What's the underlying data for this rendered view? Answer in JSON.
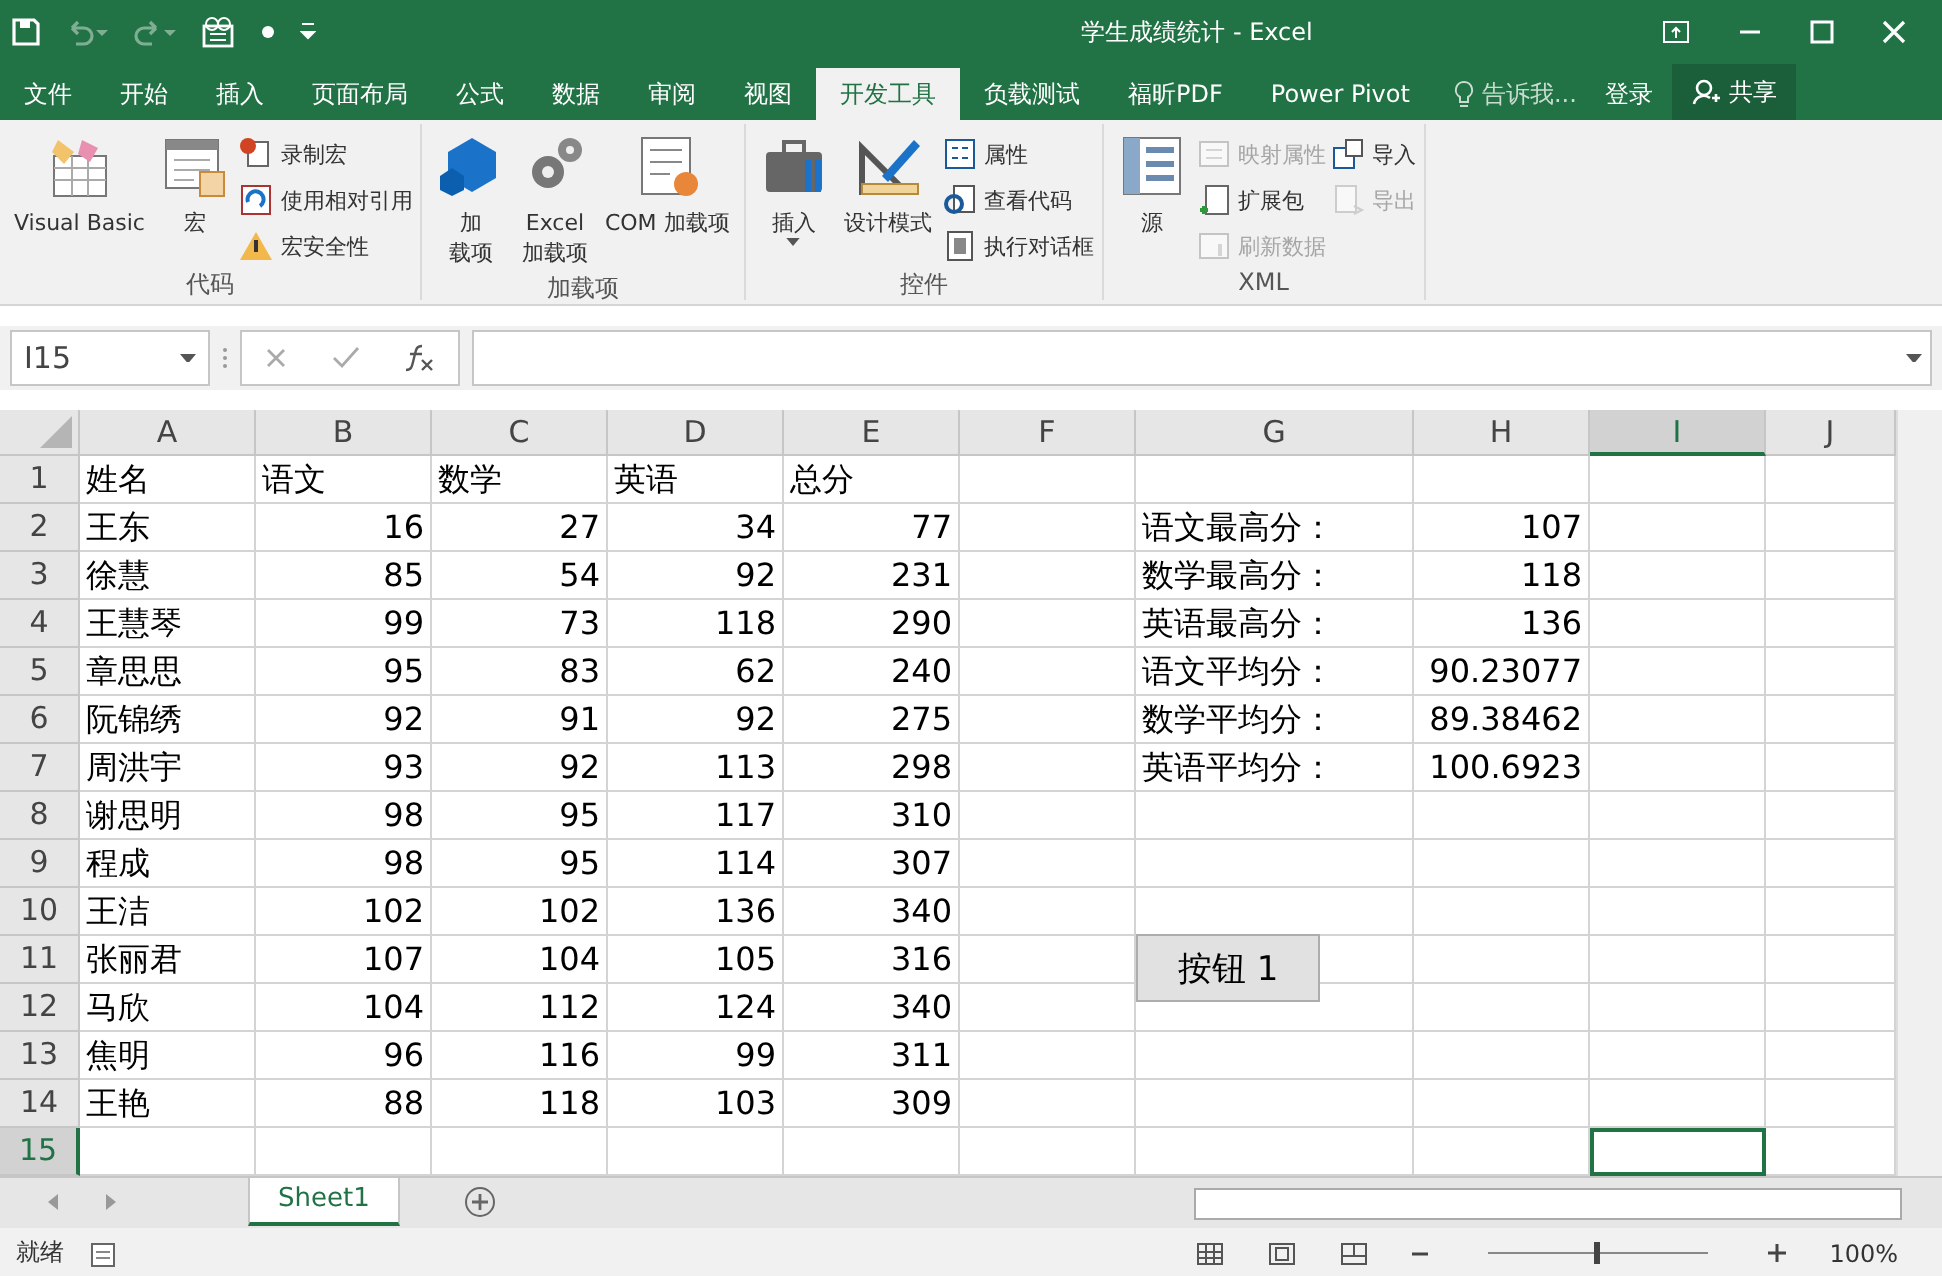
{
  "window": {
    "title": "学生成绩统计 - Excel"
  },
  "tabs": [
    {
      "label": "文件",
      "selected": false
    },
    {
      "label": "开始",
      "selected": false
    },
    {
      "label": "插入",
      "selected": false
    },
    {
      "label": "页面布局",
      "selected": false
    },
    {
      "label": "公式",
      "selected": false
    },
    {
      "label": "数据",
      "selected": false
    },
    {
      "label": "审阅",
      "selected": false
    },
    {
      "label": "视图",
      "selected": false
    },
    {
      "label": "开发工具",
      "selected": true
    },
    {
      "label": "负载测试",
      "selected": false
    },
    {
      "label": "福昕PDF",
      "selected": false
    },
    {
      "label": "Power Pivot",
      "selected": false
    }
  ],
  "tell_me": {
    "placeholder": "告诉我..."
  },
  "login": "登录",
  "share": "共享",
  "ribbon": [
    {
      "name": "代码",
      "items": [
        {
          "kind": "large",
          "lines": [
            "Visual Basic"
          ]
        },
        {
          "kind": "large",
          "lines": [
            "宏"
          ]
        },
        {
          "kind": "stack",
          "entries": [
            {
              "label": "录制宏",
              "disabled": false
            },
            {
              "label": "使用相对引用",
              "disabled": false
            },
            {
              "label": "宏安全性",
              "disabled": false
            }
          ]
        }
      ]
    },
    {
      "name": "加载项",
      "items": [
        {
          "kind": "large",
          "lines": [
            "加",
            "载项"
          ]
        },
        {
          "kind": "large",
          "lines": [
            "Excel",
            "加载项"
          ]
        },
        {
          "kind": "large",
          "lines": [
            "COM 加载项"
          ]
        }
      ]
    },
    {
      "name": "控件",
      "items": [
        {
          "kind": "large",
          "lines": [
            "插入"
          ],
          "dropdown": true
        },
        {
          "kind": "large",
          "lines": [
            "设计模式"
          ]
        },
        {
          "kind": "stack",
          "entries": [
            {
              "label": "属性",
              "disabled": false
            },
            {
              "label": "查看代码",
              "disabled": false
            },
            {
              "label": "执行对话框",
              "disabled": false
            }
          ]
        }
      ]
    },
    {
      "name": "XML",
      "items": [
        {
          "kind": "large",
          "lines": [
            "源"
          ]
        },
        {
          "kind": "stack",
          "entries": [
            {
              "label": "映射属性",
              "disabled": true
            },
            {
              "label": "扩展包",
              "disabled": false
            },
            {
              "label": "刷新数据",
              "disabled": true
            }
          ]
        },
        {
          "kind": "stack",
          "entries": [
            {
              "label": "导入",
              "disabled": false
            },
            {
              "label": "导出",
              "disabled": true
            }
          ]
        }
      ]
    }
  ],
  "name_box": "I15",
  "columns": [
    {
      "label": "A",
      "selected": false
    },
    {
      "label": "B",
      "selected": false
    },
    {
      "label": "C",
      "selected": false
    },
    {
      "label": "D",
      "selected": false
    },
    {
      "label": "E",
      "selected": false
    },
    {
      "label": "F",
      "selected": false
    },
    {
      "label": "G",
      "selected": false
    },
    {
      "label": "H",
      "selected": false
    },
    {
      "label": "I",
      "selected": true
    },
    {
      "label": "J",
      "selected": false
    }
  ],
  "rows": [
    {
      "number": "1",
      "selected": false,
      "texts": {
        "A": "姓名",
        "B": "语文",
        "C": "数学",
        "D": "英语",
        "E": "总分"
      },
      "numbers": {}
    },
    {
      "number": "2",
      "selected": false,
      "texts": {
        "A": "王东",
        "G": "语文最高分："
      },
      "numbers": {
        "B": "16",
        "C": "27",
        "D": "34",
        "E": "77",
        "H": "107"
      }
    },
    {
      "number": "3",
      "selected": false,
      "texts": {
        "A": "徐慧",
        "G": "数学最高分："
      },
      "numbers": {
        "B": "85",
        "C": "54",
        "D": "92",
        "E": "231",
        "H": "118"
      }
    },
    {
      "number": "4",
      "selected": false,
      "texts": {
        "A": "王慧琴",
        "G": "英语最高分："
      },
      "numbers": {
        "B": "99",
        "C": "73",
        "D": "118",
        "E": "290",
        "H": "136"
      }
    },
    {
      "number": "5",
      "selected": false,
      "texts": {
        "A": "章思思",
        "G": "语文平均分："
      },
      "numbers": {
        "B": "95",
        "C": "83",
        "D": "62",
        "E": "240",
        "H": "90.23077"
      }
    },
    {
      "number": "6",
      "selected": false,
      "texts": {
        "A": "阮锦绣",
        "G": "数学平均分："
      },
      "numbers": {
        "B": "92",
        "C": "91",
        "D": "92",
        "E": "275",
        "H": "89.38462"
      }
    },
    {
      "number": "7",
      "selected": false,
      "texts": {
        "A": "周洪宇",
        "G": "英语平均分："
      },
      "numbers": {
        "B": "93",
        "C": "92",
        "D": "113",
        "E": "298",
        "H": "100.6923"
      }
    },
    {
      "number": "8",
      "selected": false,
      "texts": {
        "A": "谢思明"
      },
      "numbers": {
        "B": "98",
        "C": "95",
        "D": "117",
        "E": "310"
      }
    },
    {
      "number": "9",
      "selected": false,
      "texts": {
        "A": "程成"
      },
      "numbers": {
        "B": "98",
        "C": "95",
        "D": "114",
        "E": "307"
      }
    },
    {
      "number": "10",
      "selected": false,
      "texts": {
        "A": "王洁"
      },
      "numbers": {
        "B": "102",
        "C": "102",
        "D": "136",
        "E": "340"
      }
    },
    {
      "number": "11",
      "selected": false,
      "texts": {
        "A": "张丽君"
      },
      "numbers": {
        "B": "107",
        "C": "104",
        "D": "105",
        "E": "316"
      }
    },
    {
      "number": "12",
      "selected": false,
      "texts": {
        "A": "马欣"
      },
      "numbers": {
        "B": "104",
        "C": "112",
        "D": "124",
        "E": "340"
      }
    },
    {
      "number": "13",
      "selected": false,
      "texts": {
        "A": "焦明"
      },
      "numbers": {
        "B": "96",
        "C": "116",
        "D": "99",
        "E": "311"
      }
    },
    {
      "number": "14",
      "selected": false,
      "texts": {
        "A": "王艳"
      },
      "numbers": {
        "B": "88",
        "C": "118",
        "D": "103",
        "E": "309"
      }
    },
    {
      "number": "15",
      "selected": true,
      "texts": {},
      "numbers": {}
    }
  ],
  "sheet_button": {
    "label": "按钮 1"
  },
  "sheet_tabs": [
    {
      "label": "Sheet1",
      "selected": true
    }
  ],
  "status_bar": {
    "status": "就绪",
    "zoom": "100%",
    "zoom_level": {
      "level": 0.5
    }
  }
}
